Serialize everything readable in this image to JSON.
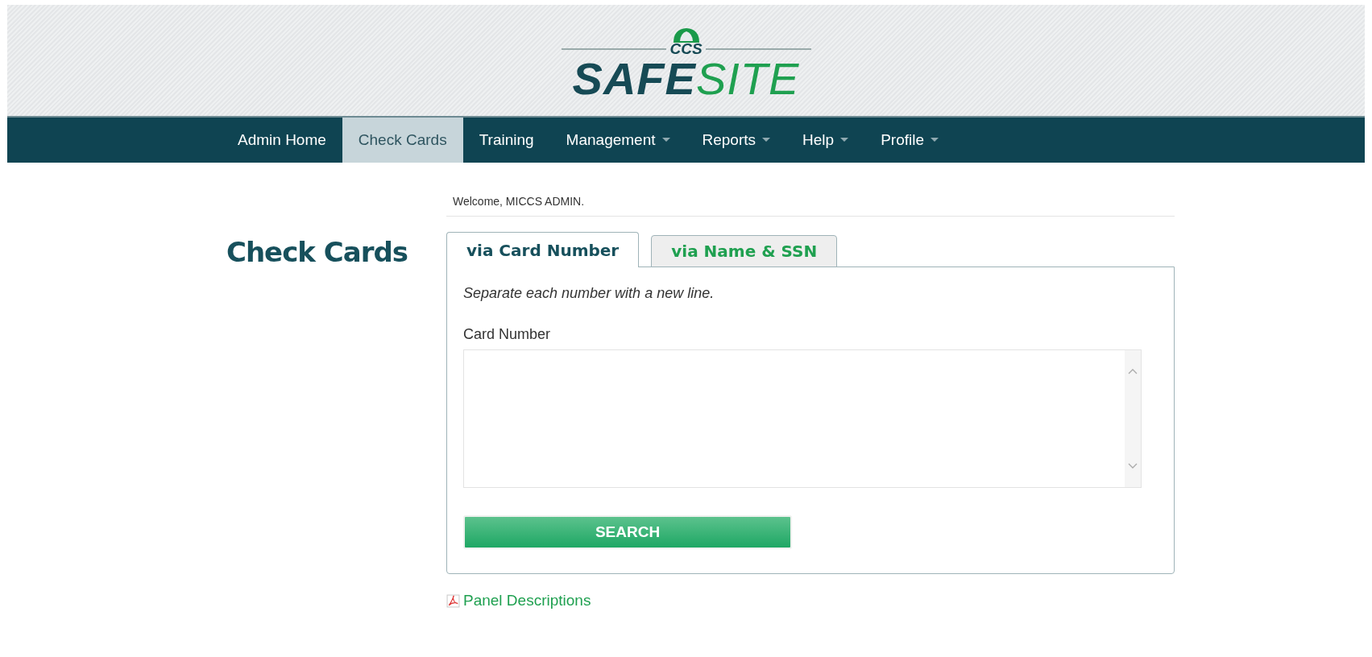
{
  "logo": {
    "top": "CCS",
    "left": "SAFE",
    "right": "SITE"
  },
  "nav": [
    {
      "label": "Admin Home",
      "selected": false,
      "dropdown": false
    },
    {
      "label": "Check Cards",
      "selected": true,
      "dropdown": false
    },
    {
      "label": "Training",
      "selected": false,
      "dropdown": false
    },
    {
      "label": "Management",
      "selected": false,
      "dropdown": true
    },
    {
      "label": "Reports",
      "selected": false,
      "dropdown": true
    },
    {
      "label": "Help",
      "selected": false,
      "dropdown": true
    },
    {
      "label": "Profile",
      "selected": false,
      "dropdown": true
    }
  ],
  "welcome": "Welcome, MICCS ADMIN.",
  "heading": "Check Cards",
  "tabs": [
    {
      "label": "via Card Number",
      "selected": true
    },
    {
      "label": "via Name & SSN",
      "selected": false
    }
  ],
  "hint": "Separate each number with a new line.",
  "field_label": "Card Number",
  "button": "SEARCH",
  "link": "Panel Descriptions"
}
